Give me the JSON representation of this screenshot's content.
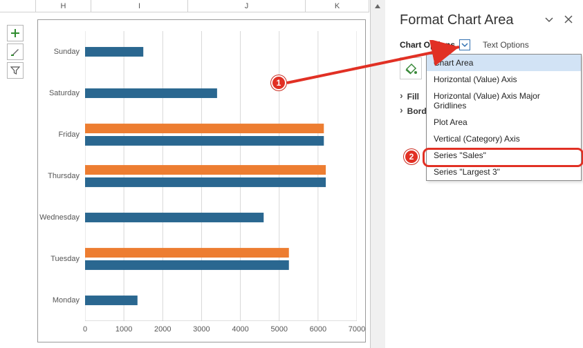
{
  "columns": [
    {
      "label": "",
      "width": 52
    },
    {
      "label": "H",
      "width": 80
    },
    {
      "label": "I",
      "width": 140
    },
    {
      "label": "J",
      "width": 170
    },
    {
      "label": "K",
      "width": 92
    }
  ],
  "toolbar": {
    "plus_name": "plus-icon",
    "brush_name": "brush-icon",
    "funnel_name": "funnel-icon"
  },
  "pane": {
    "title": "Format Chart Area",
    "chart_options_label": "Chart Options",
    "text_options_label": "Text Options",
    "sections": {
      "fill": "Fill",
      "border": "Border"
    }
  },
  "dropdown": {
    "items": [
      "Chart Area",
      "Horizontal (Value) Axis",
      "Horizontal (Value) Axis Major Gridlines",
      "Plot Area",
      "Vertical (Category) Axis",
      "Series \"Sales\"",
      "Series \"Largest 3\""
    ],
    "selected_index": 0
  },
  "callouts": {
    "one": "1",
    "two": "2"
  },
  "chart_data": {
    "type": "bar",
    "categories": [
      "Sunday",
      "Saturday",
      "Friday",
      "Thursday",
      "Wednesday",
      "Tuesday",
      "Monday"
    ],
    "series": [
      {
        "name": "Sales",
        "color": "#2a6790",
        "values": [
          1500,
          3400,
          6150,
          6200,
          4600,
          5250,
          1350
        ]
      },
      {
        "name": "Largest 3",
        "color": "#ed7d31",
        "values": [
          null,
          null,
          6150,
          6200,
          null,
          5250,
          null
        ]
      }
    ],
    "x_ticks": [
      0,
      1000,
      2000,
      3000,
      4000,
      5000,
      6000,
      7000
    ],
    "xlim": [
      0,
      7000
    ],
    "title": "",
    "xlabel": "",
    "ylabel": ""
  }
}
